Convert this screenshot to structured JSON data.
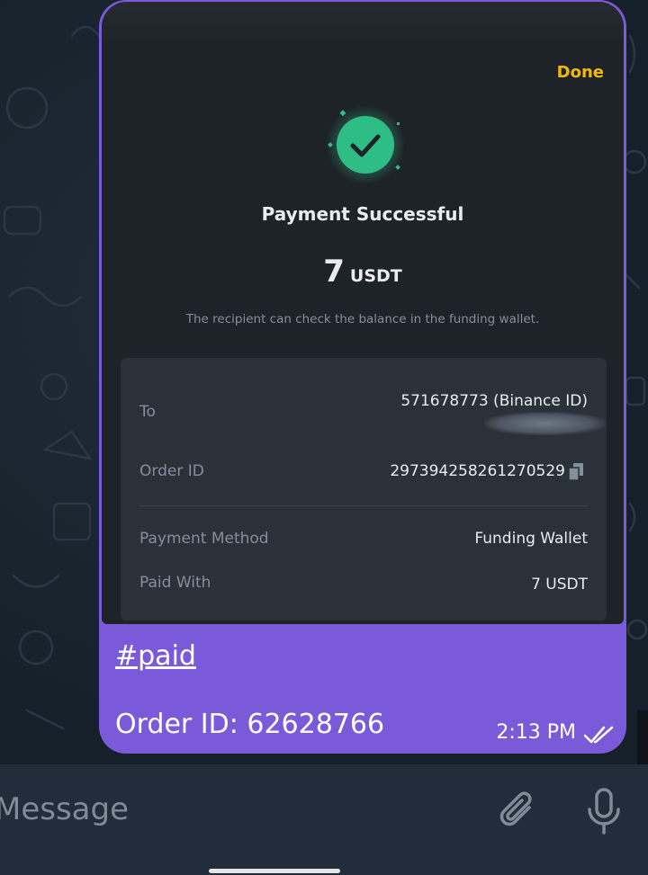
{
  "receipt": {
    "done_label": "Done",
    "title": "Payment Successful",
    "amount": "7",
    "unit": "USDT",
    "note": "The recipient can check the balance in the funding wallet.",
    "rows": {
      "to_label": "To",
      "to_value": "571678773 (Binance ID)",
      "order_label": "Order ID",
      "order_value": "297394258261270529",
      "method_label": "Payment Method",
      "method_value": "Funding Wallet",
      "paid_label": "Paid With",
      "paid_value": "7 USDT"
    }
  },
  "message": {
    "hashtag": "#paid",
    "order_line": "Order ID: 62628766",
    "time": "2:13 PM"
  },
  "input": {
    "placeholder": "Message"
  },
  "colors": {
    "accent": "#f0b90b",
    "success": "#2ebd85",
    "bubble": "#7a5ad9"
  }
}
